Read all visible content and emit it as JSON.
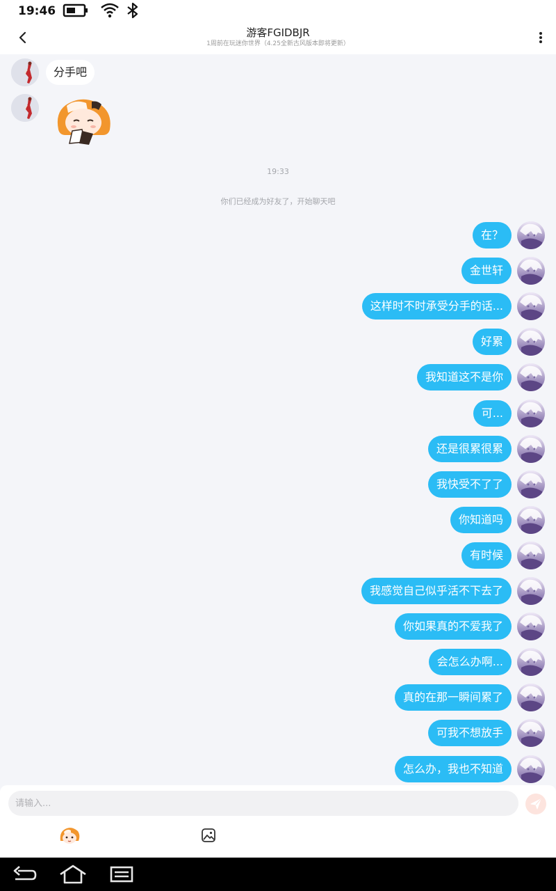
{
  "status_bar": {
    "time": "19:46",
    "icons": [
      "battery-icon",
      "wifi-icon",
      "bluetooth-icon"
    ]
  },
  "header": {
    "title": "游客FGIDBJR",
    "subtitle": "1周前在玩迷你世界（4.25全新古风版本即将更新）",
    "back_icon": "chevron-left-icon",
    "more_icon": "more-vertical-icon"
  },
  "chat": {
    "incoming": [
      {
        "type": "text",
        "text": "分手吧"
      },
      {
        "type": "sticker",
        "sticker": "crying-girl-sticker"
      }
    ],
    "timestamp": "19:33",
    "system_message": "你们已经成为好友了，开始聊天吧",
    "outgoing": [
      "在？",
      "金世轩",
      "这样时不时承受分手的话...",
      "好累",
      "我知道这不是你",
      "可...",
      "还是很累很累",
      "我快受不了了",
      "你知道吗",
      "有时候",
      "我感觉自己似乎活不下去了",
      "你如果真的不爱我了",
      "会怎么办啊...",
      "真的在那一瞬间累了",
      "可我不想放手",
      "怎么办，我也不知道"
    ]
  },
  "input_bar": {
    "placeholder": "请输入...",
    "value": "",
    "send_icon": "send-icon",
    "tools": [
      "emoji-sticker-icon",
      "image-icon"
    ]
  },
  "nav_bar": {
    "buttons": [
      "back-icon",
      "home-icon",
      "recents-icon"
    ]
  },
  "colors": {
    "outgoing_bubble": "#2bbcf5",
    "background": "#f4f5f9",
    "send_button": "#fde4de"
  }
}
